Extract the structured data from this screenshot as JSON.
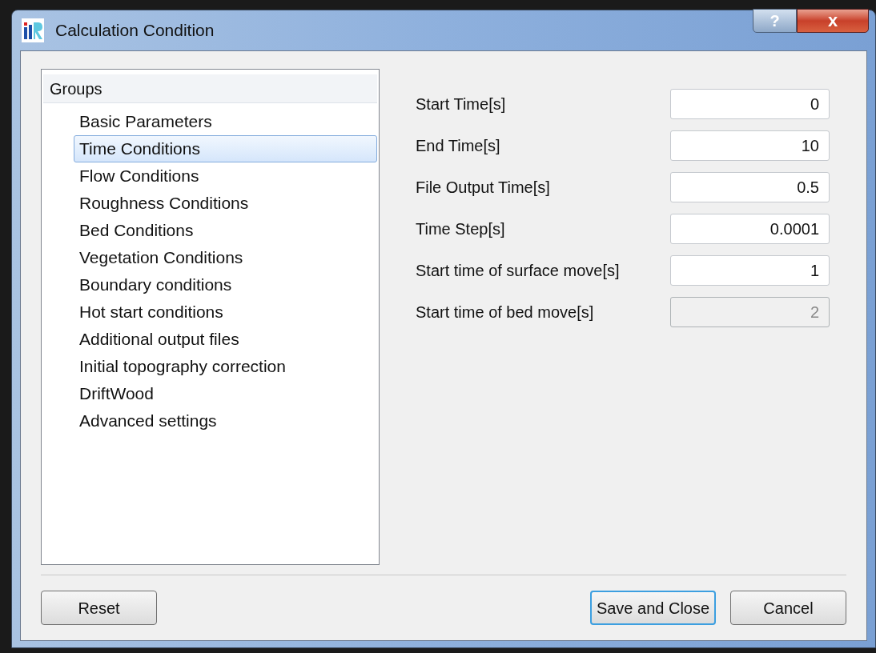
{
  "window": {
    "title": "Calculation Condition",
    "buttons": [
      "?",
      "x"
    ]
  },
  "groups": {
    "header": "Groups",
    "items": [
      {
        "label": "Basic Parameters",
        "selected": false
      },
      {
        "label": "Time Conditions",
        "selected": true
      },
      {
        "label": "Flow Conditions",
        "selected": false
      },
      {
        "label": "Roughness Conditions",
        "selected": false
      },
      {
        "label": "Bed Conditions",
        "selected": false
      },
      {
        "label": "Vegetation Conditions",
        "selected": false
      },
      {
        "label": "Boundary conditions",
        "selected": false
      },
      {
        "label": "Hot start conditions",
        "selected": false
      },
      {
        "label": "Additional output files",
        "selected": false
      },
      {
        "label": "Initial topography correction",
        "selected": false
      },
      {
        "label": "DriftWood",
        "selected": false
      },
      {
        "label": "Advanced settings",
        "selected": false
      }
    ]
  },
  "fields": [
    {
      "label": "Start Time[s]",
      "value": "0",
      "disabled": false
    },
    {
      "label": "End Time[s]",
      "value": "10",
      "disabled": false
    },
    {
      "label": "File Output Time[s]",
      "value": "0.5",
      "disabled": false
    },
    {
      "label": "Time Step[s]",
      "value": "0.0001",
      "disabled": false
    },
    {
      "label": "Start time of surface move[s]",
      "value": "1",
      "disabled": false
    },
    {
      "label": "Start time of bed move[s]",
      "value": "2",
      "disabled": true
    }
  ],
  "buttons": [
    {
      "label": "Reset",
      "default": false
    },
    {
      "label": "Save and Close",
      "default": true
    },
    {
      "label": "Cancel",
      "default": false
    }
  ]
}
